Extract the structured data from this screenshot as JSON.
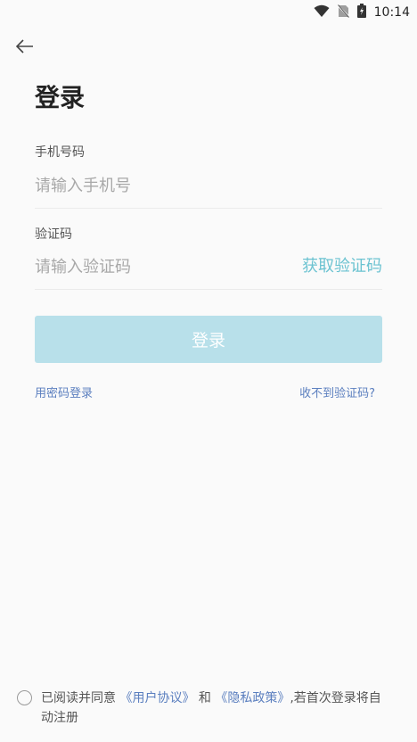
{
  "status_bar": {
    "time": "10:14",
    "icons": [
      "wifi-icon",
      "no-sim-icon",
      "battery-charging-icon"
    ]
  },
  "header": {
    "back_icon": "arrow-left-icon",
    "title": "登录"
  },
  "form": {
    "phone": {
      "label": "手机号码",
      "placeholder": "请输入手机号",
      "value": ""
    },
    "code": {
      "label": "验证码",
      "placeholder": "请输入验证码",
      "value": "",
      "get_code_label": "获取验证码"
    },
    "submit_label": "登录"
  },
  "links": {
    "password_login": "用密码登录",
    "no_code": "收不到验证码?"
  },
  "agreement": {
    "checked": false,
    "prefix": "已阅读并同意",
    "user_agreement": "《用户协议》",
    "and": "和",
    "privacy_policy": "《隐私政策》",
    "suffix": ",若首次登录将自动注册"
  },
  "colors": {
    "accent": "#6cc3d1",
    "button_bg": "#b8e0ea",
    "link": "#5b7fbf",
    "background": "#fafafa"
  }
}
